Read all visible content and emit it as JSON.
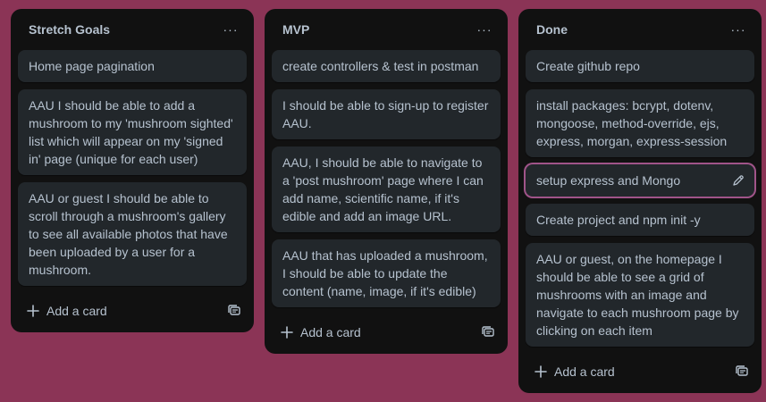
{
  "lists": [
    {
      "title": "Stretch Goals",
      "menu_label": "···",
      "cards": [
        "Home page pagination",
        "AAU I should be able to add a mushroom to my 'mushroom sighted' list which will appear on my 'signed in' page (unique for each user)",
        "AAU or guest I should be able to scroll through a mushroom's gallery to see all available photos that have been uploaded by a user for a mushroom."
      ],
      "add_card_label": "Add a card"
    },
    {
      "title": "MVP",
      "menu_label": "···",
      "cards": [
        "create controllers & test in postman",
        "I should be able to sign-up to register AAU.",
        "AAU, I should be able to navigate to a 'post mushroom' page where I can add name, scientific name, if it's edible and add an image URL.",
        "AAU that has uploaded a mushroom, I should be able to update the content (name, image, if it's edible)"
      ],
      "add_card_label": "Add a card"
    },
    {
      "title": "Done",
      "menu_label": "···",
      "cards": [
        "Create github repo",
        "install packages: bcrypt, dotenv, mongoose, method-override, ejs, express, morgan, express-session",
        "setup express and Mongo",
        "Create project and npm init -y",
        "AAU or guest, on the homepage I should be able to see a grid of mushrooms with an image and navigate to each mushroom page by clicking on each item"
      ],
      "add_card_label": "Add a card"
    }
  ],
  "icons": {
    "edit": "pencil-icon",
    "add": "plus-icon",
    "template": "card-template-icon"
  },
  "colors": {
    "background": "#8b3456",
    "list_bg": "#111111",
    "card_bg": "#22272b",
    "text": "#b6c2cf",
    "focus_ring": "#a05489"
  }
}
